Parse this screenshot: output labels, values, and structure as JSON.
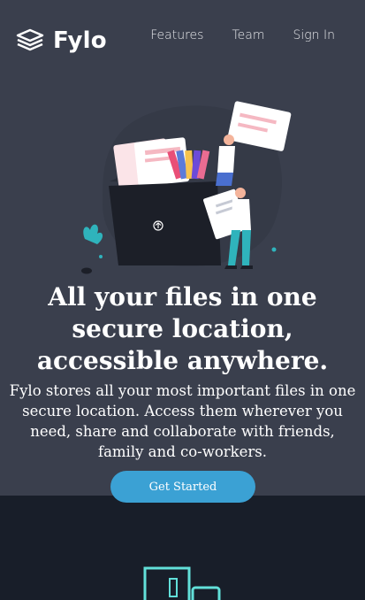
{
  "brand": {
    "name": "Fylo",
    "icon": "stacked-layers-icon"
  },
  "nav": [
    {
      "label": "Features"
    },
    {
      "label": "Team"
    },
    {
      "label": "Sign In"
    }
  ],
  "hero": {
    "illustration": "files-illustration",
    "title": "All your files in one secure location, accessible anywhere.",
    "description": "Fylo stores all your most important files in one secure location. Access them wherever you need, share and collaborate with friends, family and co-workers.",
    "cta_label": "Get Started"
  },
  "features": {
    "icon": "access-anywhere-icon"
  },
  "colors": {
    "hero_bg": "#3a3f4d",
    "page_bg": "#181e29",
    "accent": "#3ba1d4",
    "teal": "#62e0d9"
  }
}
